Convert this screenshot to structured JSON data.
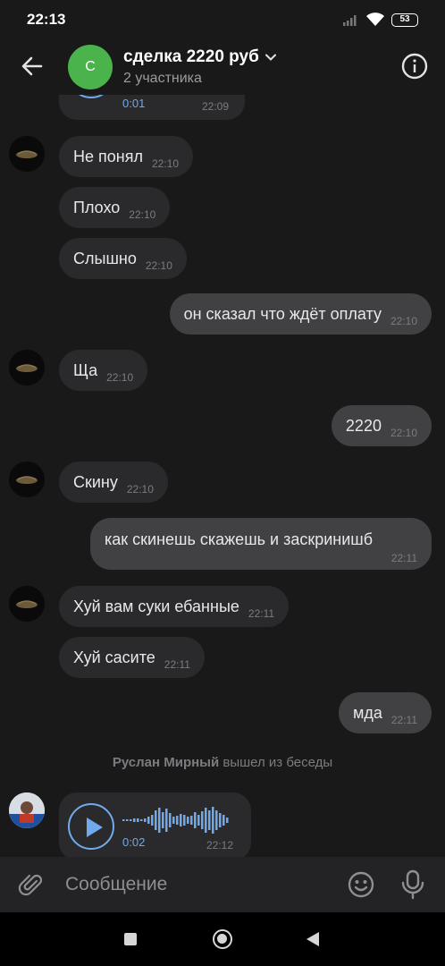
{
  "status_bar": {
    "time": "22:13",
    "battery": "53"
  },
  "header": {
    "avatar_letter": "С",
    "title": "сделка 2220 руб",
    "subtitle": "2 участника",
    "back_icon": "arrow-left-icon",
    "info_icon": "info-icon"
  },
  "messages": {
    "partial_voice": {
      "duration": "0:01",
      "time": "22:09"
    },
    "m1": {
      "text": "Не понял",
      "time": "22:10"
    },
    "m2": {
      "text": "Плохо",
      "time": "22:10"
    },
    "m3": {
      "text": "Слышно",
      "time": "22:10"
    },
    "m4": {
      "text": "он сказал что ждёт оплату",
      "time": "22:10"
    },
    "m5": {
      "text": "Ща",
      "time": "22:10"
    },
    "m6": {
      "text": "2220",
      "time": "22:10"
    },
    "m7": {
      "text": "Скину",
      "time": "22:10"
    },
    "m8": {
      "text": "как скинешь скажешь и заскринишб",
      "time": "22:11"
    },
    "m9": {
      "text": "Хуй вам суки ебанные",
      "time": "22:11"
    },
    "m10": {
      "text": "Хуй сасите",
      "time": "22:11"
    },
    "m11": {
      "text": "мда",
      "time": "22:11"
    },
    "system": {
      "name": "Руслан Мирный",
      "action": "вышел из беседы"
    },
    "voice": {
      "duration": "0:02",
      "time": "22:12"
    }
  },
  "composer": {
    "placeholder": "Сообщение"
  },
  "colors": {
    "accent": "#71aaeb",
    "avatar_green": "#4bb34b",
    "bubble_in": "#2a2a2c",
    "bubble_out": "#414144",
    "background": "#19191a"
  }
}
